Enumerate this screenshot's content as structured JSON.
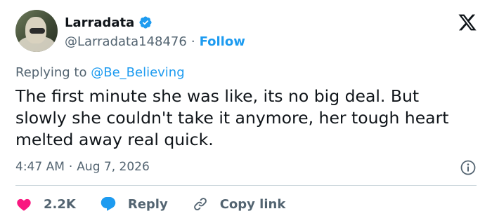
{
  "author": {
    "name": "Larradata",
    "handle": "@Larradata148476",
    "separator": "·",
    "follow_label": "Follow"
  },
  "reply_context": {
    "prefix": "Replying to",
    "target": "@Be_Believing"
  },
  "tweet": {
    "text": "The first minute she was like, its no big deal. But slowly she couldn't take it anymore, her tough heart melted away real quick.",
    "time": "4:47 AM",
    "separator": "·",
    "date": "Aug 7, 2026"
  },
  "actions": {
    "likes": "2.2K",
    "reply_label": "Reply",
    "copy_link_label": "Copy link"
  },
  "colors": {
    "accent": "#1d9bf0",
    "like": "#f91880",
    "muted": "#536471",
    "text": "#0f1419"
  },
  "icons": [
    "avatar",
    "verified-badge-icon",
    "x-logo-icon",
    "info-icon",
    "heart-icon",
    "reply-bubble-icon",
    "link-icon"
  ]
}
